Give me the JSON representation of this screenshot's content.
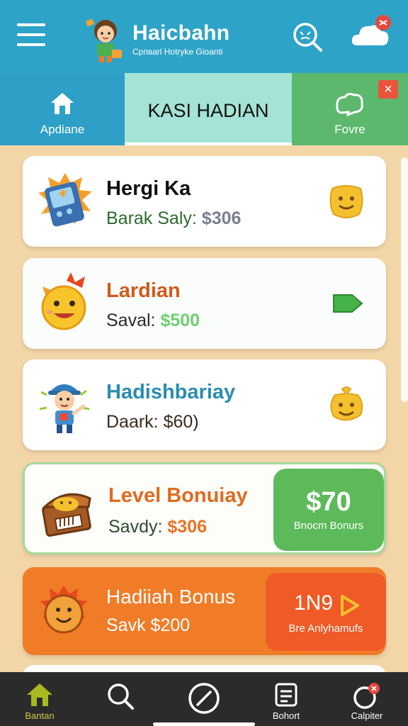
{
  "header": {
    "title": "Haicbahn",
    "subtitle": "Cрпваrl Hotrуke Gioanti"
  },
  "tabs": [
    {
      "label": "Apdiane"
    },
    {
      "label": "KASI HADIAN"
    },
    {
      "label": "Fovre"
    }
  ],
  "cards": [
    {
      "title": "Hergi Ka",
      "prefix": "Barak Saly:",
      "amount": "$306"
    },
    {
      "title": "Lardian",
      "prefix": "Saval:",
      "amount": "$500"
    },
    {
      "title": "Hadishbariay",
      "prefix": "Daark:",
      "amount": "$60)"
    },
    {
      "title": "Level Bonuiay",
      "prefix": "Savdy:",
      "amount": "$306",
      "bonus_amount": "$70",
      "bonus_label": "Bnocm Bonurs"
    },
    {
      "title": "Hadiiah Bonus",
      "prefix": "Savk",
      "amount": "$200",
      "bonus_amount": "1N9",
      "bonus_label": "Bre Anlyhamufs"
    }
  ],
  "nav": [
    {
      "label": "Bantan"
    },
    {
      "label": ""
    },
    {
      "label": ""
    },
    {
      "label": "Bohort"
    },
    {
      "label": "Calpiter"
    }
  ],
  "colors": {
    "header": "#2ea3c8",
    "background": "#f3d6a8",
    "green": "#5cba5a",
    "orange": "#f07c28"
  }
}
